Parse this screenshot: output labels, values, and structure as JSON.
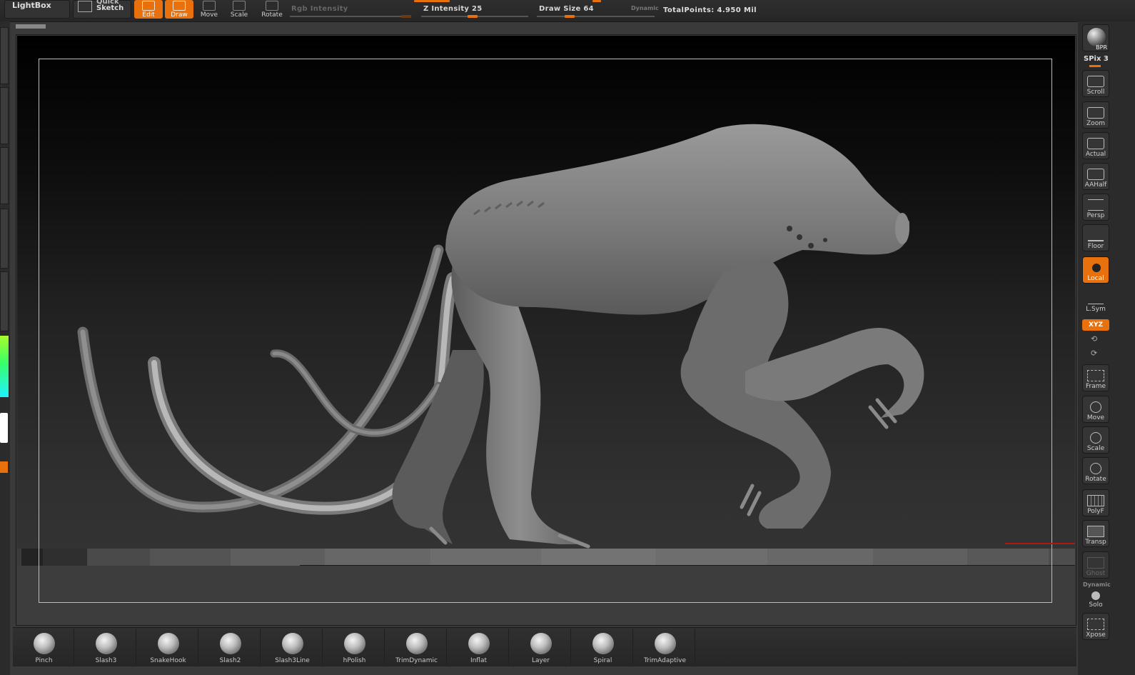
{
  "toolbar": {
    "lightbox": "LightBox",
    "quick_sketch_line1": "Quick",
    "quick_sketch_line2": "Sketch",
    "edit": "Edit",
    "draw": "Draw",
    "move": "Move",
    "scale": "Scale",
    "rotate": "Rotate",
    "rgb_intensity": "Rgb Intensity",
    "z_intensity": "Z Intensity 25",
    "draw_size": "Draw Size 64",
    "dynamic": "Dynamic",
    "total_points": "TotalPoints: 4.950 Mil"
  },
  "right_shelf": {
    "bpr": "BPR",
    "spix": "SPix 3",
    "scroll": "Scroll",
    "zoom": "Zoom",
    "actual": "Actual",
    "aahalf": "AAHalf",
    "persp": "Persp",
    "floor": "Floor",
    "local": "Local",
    "lsym": "L.Sym",
    "xyz": "XYZ",
    "frame": "Frame",
    "move": "Move",
    "scale": "Scale",
    "rotate": "Rotate",
    "polyf": "PolyF",
    "transp": "Transp",
    "ghost": "Ghost",
    "dynamic": "Dynamic",
    "solo": "Solo",
    "xpose": "Xpose"
  },
  "brushes": [
    {
      "label": "Pinch"
    },
    {
      "label": "Slash3"
    },
    {
      "label": "SnakeHook"
    },
    {
      "label": "Slash2"
    },
    {
      "label": "Slash3Line"
    },
    {
      "label": "hPolish"
    },
    {
      "label": "TrimDynamic"
    },
    {
      "label": "Inflat"
    },
    {
      "label": "Layer"
    },
    {
      "label": "Spiral"
    },
    {
      "label": "TrimAdaptive"
    }
  ],
  "colors": {
    "accent": "#e8700d",
    "panel": "#2b2b2b",
    "canvas_top": "#000000",
    "canvas_bottom": "#333333"
  }
}
